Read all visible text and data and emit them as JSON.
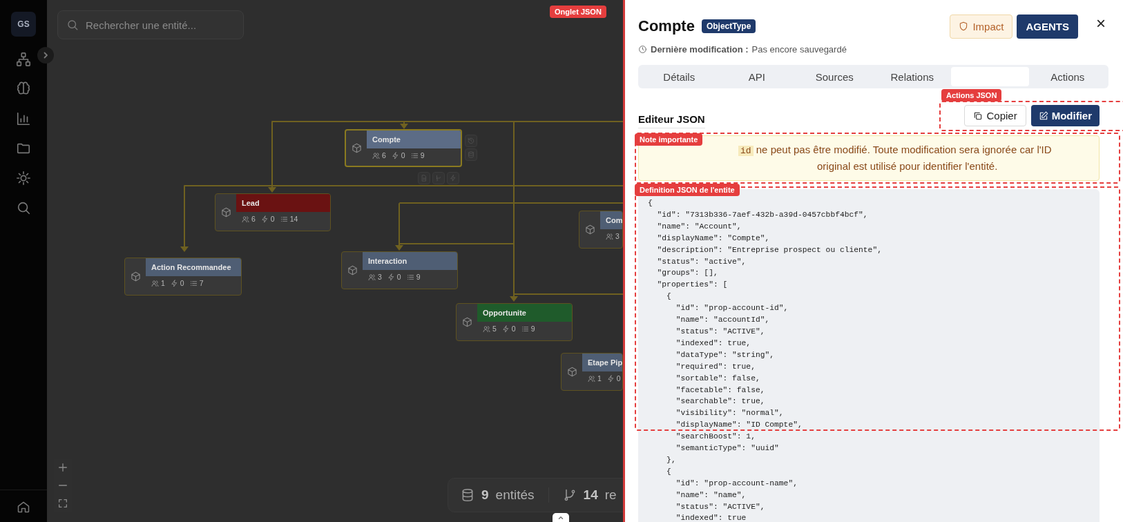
{
  "sidebar": {
    "avatar": "GS"
  },
  "search": {
    "placeholder": "Rechercher une entité..."
  },
  "canvas": {
    "nodes": [
      {
        "name": "Compte",
        "color": "#5c6c86",
        "selected": true,
        "metrics": [
          "6",
          "0",
          "9"
        ]
      },
      {
        "name": "Lead",
        "color": "#6a1212",
        "selected": false,
        "metrics": [
          "6",
          "0",
          "14"
        ]
      },
      {
        "name": "Action Recommandee",
        "color": "#4f5e74",
        "selected": false,
        "metrics": [
          "1",
          "0",
          "7"
        ]
      },
      {
        "name": "Interaction",
        "color": "#4f5e74",
        "selected": false,
        "metrics": [
          "3",
          "0",
          "9"
        ]
      },
      {
        "name": "Opportunite",
        "color": "#1f5b2b",
        "selected": false,
        "metrics": [
          "5",
          "0",
          "9"
        ]
      },
      {
        "name": "Com",
        "color": "#4f5e74",
        "selected": false,
        "metrics": [
          "3"
        ]
      },
      {
        "name": "Etape Pip",
        "color": "#4f5e74",
        "selected": false,
        "metrics": [
          "1",
          "0"
        ]
      }
    ]
  },
  "stats": [
    {
      "count": "9",
      "label": "entités"
    },
    {
      "count": "14",
      "label": "re"
    }
  ],
  "tour": [
    {
      "kind": "tab",
      "label": "Onglet JSON"
    },
    {
      "kind": "actions",
      "label": "Actions JSON"
    },
    {
      "kind": "note",
      "label": "Note importante"
    },
    {
      "kind": "definition",
      "label": "Definition JSON de l'entite"
    }
  ],
  "panel": {
    "title": "Compte",
    "type_badge": "ObjectType",
    "impact_button": "Impact",
    "agents_button": "AGENTS",
    "close": "×",
    "last_modified_label": "Dernière modification :",
    "last_modified_value": "Pas encore sauvegardé",
    "tabs": [
      {
        "label": "Détails",
        "selected": false
      },
      {
        "label": "API",
        "selected": false
      },
      {
        "label": "Sources",
        "selected": false
      },
      {
        "label": "Relations",
        "selected": false
      },
      {
        "selected": true
      },
      {
        "label": "Actions",
        "selected": false
      }
    ],
    "editor_title": "Editeur JSON",
    "copy_button": "Copier",
    "edit_button": "Modifier",
    "notice": {
      "code": "id",
      "text": "ne peut pas être modifié. Toute modification sera ignorée car l'ID original est utilisé pour identifier l'entité."
    },
    "code_lines": [
      "{",
      "  \"id\": \"7313b336-7aef-432b-a39d-0457cbbf4bcf\",",
      "  \"name\": \"Account\",",
      "  \"displayName\": \"Compte\",",
      "  \"description\": \"Entreprise prospect ou cliente\",",
      "  \"status\": \"active\",",
      "  \"groups\": [],",
      "  \"properties\": [",
      "    {",
      "      \"id\": \"prop-account-id\",",
      "      \"name\": \"accountId\",",
      "      \"status\": \"ACTIVE\",",
      "      \"indexed\": true,",
      "      \"dataType\": \"string\",",
      "      \"required\": true,",
      "      \"sortable\": false,",
      "      \"facetable\": false,",
      "      \"searchable\": true,",
      "      \"visibility\": \"normal\",",
      "      \"displayName\": \"ID Compte\",",
      "      \"searchBoost\": 1,",
      "      \"semanticType\": \"uuid\"",
      "    },",
      "    {",
      "      \"id\": \"prop-account-name\",",
      "      \"name\": \"name\",",
      "      \"status\": \"ACTIVE\",",
      "      \"indexed\": true"
    ]
  }
}
